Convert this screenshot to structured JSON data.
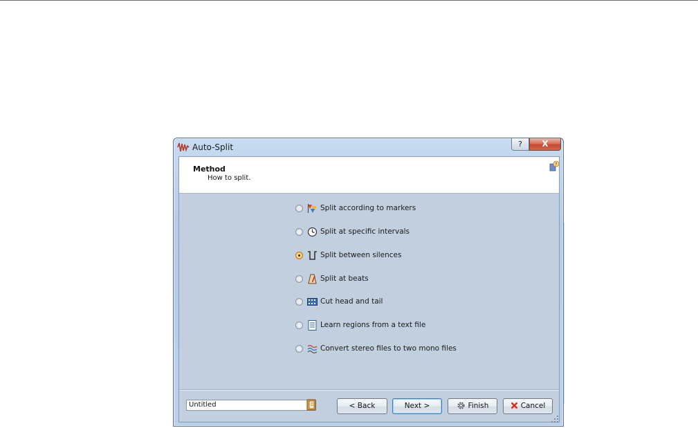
{
  "window": {
    "title": "Auto-Split"
  },
  "titlebar": {
    "help_label": "?",
    "close_label": "X"
  },
  "header": {
    "title": "Method",
    "subtitle": "How to split."
  },
  "options": [
    {
      "label": "Split according to markers",
      "icon": "markers-icon",
      "selected": false
    },
    {
      "label": "Split at specific intervals",
      "icon": "clock-icon",
      "selected": false
    },
    {
      "label": "Split between silences",
      "icon": "silence-icon",
      "selected": true
    },
    {
      "label": "Split at beats",
      "icon": "metronome-icon",
      "selected": false
    },
    {
      "label": "Cut head and tail",
      "icon": "cut-head-tail-icon",
      "selected": false
    },
    {
      "label": "Learn regions from a text file",
      "icon": "text-file-icon",
      "selected": false
    },
    {
      "label": "Convert stereo files to two mono files",
      "icon": "stereo-to-mono-icon",
      "selected": false
    }
  ],
  "footer": {
    "preset_value": "Untitled",
    "back_label": "< Back",
    "next_label": "Next >",
    "finish_label": "Finish",
    "cancel_label": "Cancel"
  },
  "colors": {
    "accent": "#3d7bbf",
    "cancel_icon": "#d62b1f",
    "selected_radio": "#f2b64c"
  }
}
